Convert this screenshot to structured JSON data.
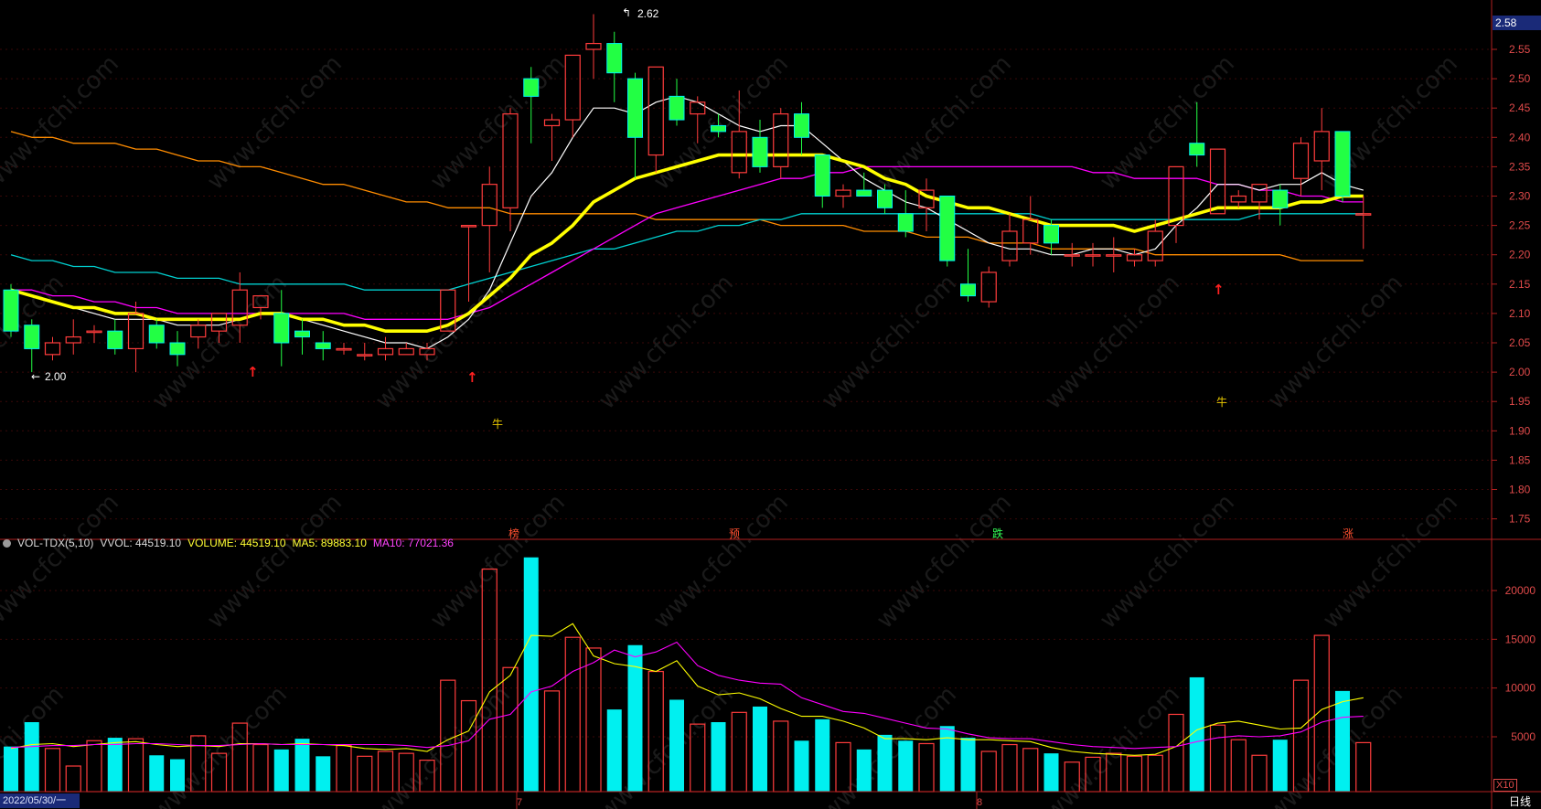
{
  "price_axis": {
    "current_price": "2.58",
    "ticks": [
      "2.55",
      "2.50",
      "2.45",
      "2.40",
      "2.35",
      "2.30",
      "2.25",
      "2.20",
      "2.15",
      "2.10",
      "2.05",
      "2.00",
      "1.95",
      "1.90",
      "1.85",
      "1.80",
      "1.75"
    ]
  },
  "annotations": {
    "high_label": "2.62",
    "low_label": "2.00",
    "bull_marker": "牛",
    "event_markers": [
      "榜",
      "预",
      "跌",
      "涨"
    ]
  },
  "x_axis": {
    "start_date": "2022/05/30/一",
    "month_labels": [
      "7",
      "8"
    ],
    "period_label": "日线"
  },
  "volume_panel": {
    "indicator": "VOL-TDX(5,10)",
    "vvol": "VVOL: 44519.10",
    "volume": "VOLUME: 44519.10",
    "ma5": "MA5: 89883.10",
    "ma10": "MA10: 77021.36",
    "unit_badge": "X10",
    "ticks": [
      "20000",
      "15000",
      "10000",
      "5000"
    ]
  },
  "colors": {
    "up": "#ff3c3c",
    "down": "#00f0f0",
    "down_body": "#22ff44",
    "ma_white": "#ffffff",
    "ma_yellow": "#ffff00",
    "ma_magenta": "#ff00ff",
    "ma_cyan": "#00d0d0",
    "ma_orange": "#ff8c00"
  },
  "chart_data": [
    {
      "type": "candlestick",
      "ylim": [
        1.73,
        2.6
      ],
      "candles": [
        {
          "o": 2.14,
          "h": 2.15,
          "l": 2.06,
          "c": 2.07
        },
        {
          "o": 2.08,
          "h": 2.09,
          "l": 2.0,
          "c": 2.04
        },
        {
          "o": 2.03,
          "h": 2.06,
          "l": 2.02,
          "c": 2.05
        },
        {
          "o": 2.05,
          "h": 2.09,
          "l": 2.03,
          "c": 2.06
        },
        {
          "o": 2.07,
          "h": 2.08,
          "l": 2.05,
          "c": 2.07
        },
        {
          "o": 2.07,
          "h": 2.09,
          "l": 2.03,
          "c": 2.04
        },
        {
          "o": 2.04,
          "h": 2.12,
          "l": 2.0,
          "c": 2.1
        },
        {
          "o": 2.08,
          "h": 2.09,
          "l": 2.04,
          "c": 2.05
        },
        {
          "o": 2.05,
          "h": 2.07,
          "l": 2.01,
          "c": 2.03
        },
        {
          "o": 2.06,
          "h": 2.09,
          "l": 2.04,
          "c": 2.08
        },
        {
          "o": 2.07,
          "h": 2.1,
          "l": 2.05,
          "c": 2.1
        },
        {
          "o": 2.08,
          "h": 2.17,
          "l": 2.05,
          "c": 2.14
        },
        {
          "o": 2.11,
          "h": 2.13,
          "l": 2.09,
          "c": 2.13
        },
        {
          "o": 2.1,
          "h": 2.14,
          "l": 2.01,
          "c": 2.05
        },
        {
          "o": 2.07,
          "h": 2.09,
          "l": 2.03,
          "c": 2.06
        },
        {
          "o": 2.05,
          "h": 2.07,
          "l": 2.02,
          "c": 2.04
        },
        {
          "o": 2.04,
          "h": 2.05,
          "l": 2.03,
          "c": 2.04
        },
        {
          "o": 2.03,
          "h": 2.05,
          "l": 2.02,
          "c": 2.03
        },
        {
          "o": 2.03,
          "h": 2.06,
          "l": 2.02,
          "c": 2.04
        },
        {
          "o": 2.03,
          "h": 2.05,
          "l": 2.03,
          "c": 2.04
        },
        {
          "o": 2.03,
          "h": 2.05,
          "l": 2.02,
          "c": 2.04
        },
        {
          "o": 2.07,
          "h": 2.14,
          "l": 2.07,
          "c": 2.14
        },
        {
          "o": 2.25,
          "h": 2.25,
          "l": 2.12,
          "c": 2.25
        },
        {
          "o": 2.25,
          "h": 2.35,
          "l": 2.17,
          "c": 2.32
        },
        {
          "o": 2.28,
          "h": 2.45,
          "l": 2.24,
          "c": 2.44
        },
        {
          "o": 2.5,
          "h": 2.52,
          "l": 2.39,
          "c": 2.47
        },
        {
          "o": 2.42,
          "h": 2.44,
          "l": 2.36,
          "c": 2.43
        },
        {
          "o": 2.43,
          "h": 2.54,
          "l": 2.4,
          "c": 2.54
        },
        {
          "o": 2.55,
          "h": 2.61,
          "l": 2.5,
          "c": 2.56
        },
        {
          "o": 2.56,
          "h": 2.58,
          "l": 2.46,
          "c": 2.51
        },
        {
          "o": 2.5,
          "h": 2.51,
          "l": 2.33,
          "c": 2.4
        },
        {
          "o": 2.37,
          "h": 2.52,
          "l": 2.34,
          "c": 2.52
        },
        {
          "o": 2.47,
          "h": 2.5,
          "l": 2.42,
          "c": 2.43
        },
        {
          "o": 2.44,
          "h": 2.47,
          "l": 2.39,
          "c": 2.46
        },
        {
          "o": 2.42,
          "h": 2.44,
          "l": 2.4,
          "c": 2.41
        },
        {
          "o": 2.34,
          "h": 2.48,
          "l": 2.33,
          "c": 2.41
        },
        {
          "o": 2.4,
          "h": 2.43,
          "l": 2.34,
          "c": 2.35
        },
        {
          "o": 2.35,
          "h": 2.45,
          "l": 2.33,
          "c": 2.44
        },
        {
          "o": 2.44,
          "h": 2.46,
          "l": 2.37,
          "c": 2.4
        },
        {
          "o": 2.37,
          "h": 2.37,
          "l": 2.28,
          "c": 2.3
        },
        {
          "o": 2.3,
          "h": 2.32,
          "l": 2.28,
          "c": 2.31
        },
        {
          "o": 2.31,
          "h": 2.34,
          "l": 2.3,
          "c": 2.3
        },
        {
          "o": 2.31,
          "h": 2.32,
          "l": 2.27,
          "c": 2.28
        },
        {
          "o": 2.27,
          "h": 2.31,
          "l": 2.23,
          "c": 2.24
        },
        {
          "o": 2.28,
          "h": 2.33,
          "l": 2.24,
          "c": 2.31
        },
        {
          "o": 2.3,
          "h": 2.3,
          "l": 2.18,
          "c": 2.19
        },
        {
          "o": 2.15,
          "h": 2.21,
          "l": 2.12,
          "c": 2.13
        },
        {
          "o": 2.12,
          "h": 2.18,
          "l": 2.11,
          "c": 2.17
        },
        {
          "o": 2.19,
          "h": 2.27,
          "l": 2.18,
          "c": 2.24
        },
        {
          "o": 2.22,
          "h": 2.3,
          "l": 2.2,
          "c": 2.26
        },
        {
          "o": 2.25,
          "h": 2.26,
          "l": 2.2,
          "c": 2.22
        },
        {
          "o": 2.2,
          "h": 2.22,
          "l": 2.18,
          "c": 2.2
        },
        {
          "o": 2.2,
          "h": 2.22,
          "l": 2.18,
          "c": 2.2
        },
        {
          "o": 2.2,
          "h": 2.23,
          "l": 2.17,
          "c": 2.2
        },
        {
          "o": 2.19,
          "h": 2.21,
          "l": 2.18,
          "c": 2.2
        },
        {
          "o": 2.19,
          "h": 2.26,
          "l": 2.18,
          "c": 2.24
        },
        {
          "o": 2.25,
          "h": 2.35,
          "l": 2.22,
          "c": 2.35
        },
        {
          "o": 2.39,
          "h": 2.46,
          "l": 2.35,
          "c": 2.37
        },
        {
          "o": 2.27,
          "h": 2.38,
          "l": 2.27,
          "c": 2.38
        },
        {
          "o": 2.29,
          "h": 2.31,
          "l": 2.28,
          "c": 2.3
        },
        {
          "o": 2.29,
          "h": 2.32,
          "l": 2.26,
          "c": 2.32
        },
        {
          "o": 2.31,
          "h": 2.32,
          "l": 2.25,
          "c": 2.28
        },
        {
          "o": 2.33,
          "h": 2.4,
          "l": 2.3,
          "c": 2.39
        },
        {
          "o": 2.36,
          "h": 2.45,
          "l": 2.31,
          "c": 2.41
        },
        {
          "o": 2.41,
          "h": 2.41,
          "l": 2.29,
          "c": 2.3
        },
        {
          "o": 2.27,
          "h": 2.3,
          "l": 2.21,
          "c": 2.27
        }
      ],
      "ma_series": [
        {
          "values": [
            2.14,
            2.13,
            2.12,
            2.11,
            2.1,
            2.09,
            2.09,
            2.09,
            2.08,
            2.08,
            2.08,
            2.09,
            2.1,
            2.1,
            2.09,
            2.08,
            2.07,
            2.06,
            2.05,
            2.05,
            2.04,
            2.06,
            2.09,
            2.14,
            2.22,
            2.3,
            2.34,
            2.4,
            2.45,
            2.45,
            2.44,
            2.46,
            2.47,
            2.46,
            2.44,
            2.42,
            2.41,
            2.42,
            2.42,
            2.39,
            2.36,
            2.33,
            2.31,
            2.29,
            2.28,
            2.26,
            2.24,
            2.22,
            2.21,
            2.21,
            2.2,
            2.2,
            2.21,
            2.21,
            2.2,
            2.21,
            2.25,
            2.28,
            2.32,
            2.32,
            2.31,
            2.32,
            2.32,
            2.34,
            2.32,
            2.31
          ]
        },
        {
          "values": [
            2.14,
            2.13,
            2.12,
            2.11,
            2.11,
            2.1,
            2.1,
            2.09,
            2.09,
            2.09,
            2.09,
            2.09,
            2.1,
            2.1,
            2.09,
            2.09,
            2.08,
            2.08,
            2.07,
            2.07,
            2.07,
            2.08,
            2.1,
            2.13,
            2.16,
            2.2,
            2.22,
            2.25,
            2.29,
            2.31,
            2.33,
            2.34,
            2.35,
            2.36,
            2.37,
            2.37,
            2.37,
            2.37,
            2.37,
            2.37,
            2.36,
            2.35,
            2.33,
            2.32,
            2.3,
            2.29,
            2.28,
            2.28,
            2.27,
            2.26,
            2.25,
            2.25,
            2.25,
            2.25,
            2.24,
            2.25,
            2.26,
            2.27,
            2.28,
            2.28,
            2.28,
            2.28,
            2.29,
            2.29,
            2.3,
            2.3
          ]
        },
        {
          "values": [
            2.14,
            2.14,
            2.13,
            2.13,
            2.12,
            2.12,
            2.11,
            2.11,
            2.1,
            2.1,
            2.1,
            2.1,
            2.1,
            2.1,
            2.1,
            2.1,
            2.1,
            2.09,
            2.09,
            2.09,
            2.09,
            2.09,
            2.1,
            2.11,
            2.13,
            2.15,
            2.17,
            2.19,
            2.21,
            2.23,
            2.25,
            2.27,
            2.28,
            2.29,
            2.3,
            2.31,
            2.32,
            2.33,
            2.33,
            2.34,
            2.34,
            2.35,
            2.35,
            2.35,
            2.35,
            2.35,
            2.35,
            2.35,
            2.35,
            2.35,
            2.35,
            2.35,
            2.34,
            2.34,
            2.33,
            2.33,
            2.33,
            2.33,
            2.32,
            2.32,
            2.31,
            2.31,
            2.3,
            2.3,
            2.29,
            2.29
          ]
        },
        {
          "values": [
            2.2,
            2.19,
            2.19,
            2.18,
            2.18,
            2.17,
            2.17,
            2.17,
            2.16,
            2.16,
            2.16,
            2.15,
            2.15,
            2.15,
            2.15,
            2.15,
            2.15,
            2.14,
            2.14,
            2.14,
            2.14,
            2.14,
            2.15,
            2.16,
            2.17,
            2.18,
            2.19,
            2.2,
            2.21,
            2.21,
            2.22,
            2.23,
            2.24,
            2.24,
            2.25,
            2.25,
            2.26,
            2.26,
            2.27,
            2.27,
            2.27,
            2.27,
            2.27,
            2.27,
            2.27,
            2.27,
            2.27,
            2.27,
            2.27,
            2.27,
            2.26,
            2.26,
            2.26,
            2.26,
            2.26,
            2.26,
            2.26,
            2.26,
            2.26,
            2.26,
            2.27,
            2.27,
            2.27,
            2.27,
            2.27,
            2.27
          ]
        },
        {
          "values": [
            2.41,
            2.4,
            2.4,
            2.39,
            2.39,
            2.39,
            2.38,
            2.38,
            2.37,
            2.36,
            2.36,
            2.35,
            2.35,
            2.34,
            2.33,
            2.32,
            2.32,
            2.31,
            2.3,
            2.29,
            2.29,
            2.28,
            2.28,
            2.28,
            2.27,
            2.27,
            2.27,
            2.27,
            2.27,
            2.27,
            2.27,
            2.26,
            2.26,
            2.26,
            2.26,
            2.26,
            2.26,
            2.25,
            2.25,
            2.25,
            2.25,
            2.24,
            2.24,
            2.24,
            2.23,
            2.23,
            2.23,
            2.22,
            2.22,
            2.22,
            2.21,
            2.21,
            2.21,
            2.21,
            2.21,
            2.2,
            2.2,
            2.2,
            2.2,
            2.2,
            2.2,
            2.2,
            2.19,
            2.19,
            2.19,
            2.19
          ]
        }
      ]
    },
    {
      "type": "bar",
      "ylim": [
        0,
        24000
      ],
      "values": [
        4000,
        6500,
        3800,
        2000,
        4600,
        4900,
        4800,
        3100,
        2700,
        5100,
        3300,
        6400,
        4200,
        3700,
        4800,
        3000,
        4100,
        3000,
        3500,
        3300,
        2600,
        10800,
        8700,
        22200,
        12100,
        23400,
        9700,
        15200,
        14100,
        7800,
        14400,
        11700,
        8800,
        6300,
        6500,
        7500,
        8100,
        6600,
        4600,
        6800,
        4400,
        3700,
        5200,
        4600,
        4300,
        6100,
        4900,
        3500,
        4200,
        3800,
        3300,
        2400,
        2900,
        3300,
        3000,
        3100,
        7300,
        11100,
        6200,
        4700,
        3100,
        4700,
        10800,
        15400,
        9700,
        4400
      ],
      "ma_series": [
        {
          "values": [
            3800,
            4200,
            4300,
            4000,
            4200,
            4400,
            4500,
            4200,
            4000,
            4100,
            4000,
            4300,
            4300,
            4200,
            4300,
            4200,
            4100,
            3800,
            3700,
            3800,
            3500,
            4700,
            5600,
            9600,
            11300,
            15400,
            15300,
            16600,
            13300,
            12500,
            12200,
            11700,
            12800,
            10200,
            9300,
            9500,
            8900,
            7900,
            7100,
            7100,
            6600,
            5900,
            4800,
            4800,
            4700,
            4900,
            4700,
            4700,
            4600,
            4500,
            3900,
            3500,
            3300,
            3200,
            3100,
            3200,
            4000,
            5700,
            6400,
            6600,
            6200,
            5800,
            5900,
            7800,
            8600,
            9000
          ]
        },
        {
          "values": [
            3900,
            4000,
            4100,
            4100,
            4200,
            4200,
            4300,
            4300,
            4200,
            4100,
            4100,
            4200,
            4300,
            4200,
            4200,
            4200,
            4200,
            4200,
            4200,
            4100,
            3900,
            4100,
            4600,
            6800,
            7300,
            9600,
            10200,
            11700,
            12600,
            13900,
            13200,
            13700,
            14700,
            12300,
            11300,
            10800,
            10500,
            10400,
            9000,
            8300,
            7600,
            7400,
            6900,
            6400,
            5900,
            5800,
            5300,
            4900,
            4800,
            4800,
            4500,
            4200,
            4000,
            3900,
            3800,
            3900,
            4000,
            4500,
            4900,
            5100,
            5000,
            5100,
            5500,
            6500,
            7000,
            7100
          ]
        }
      ]
    }
  ]
}
